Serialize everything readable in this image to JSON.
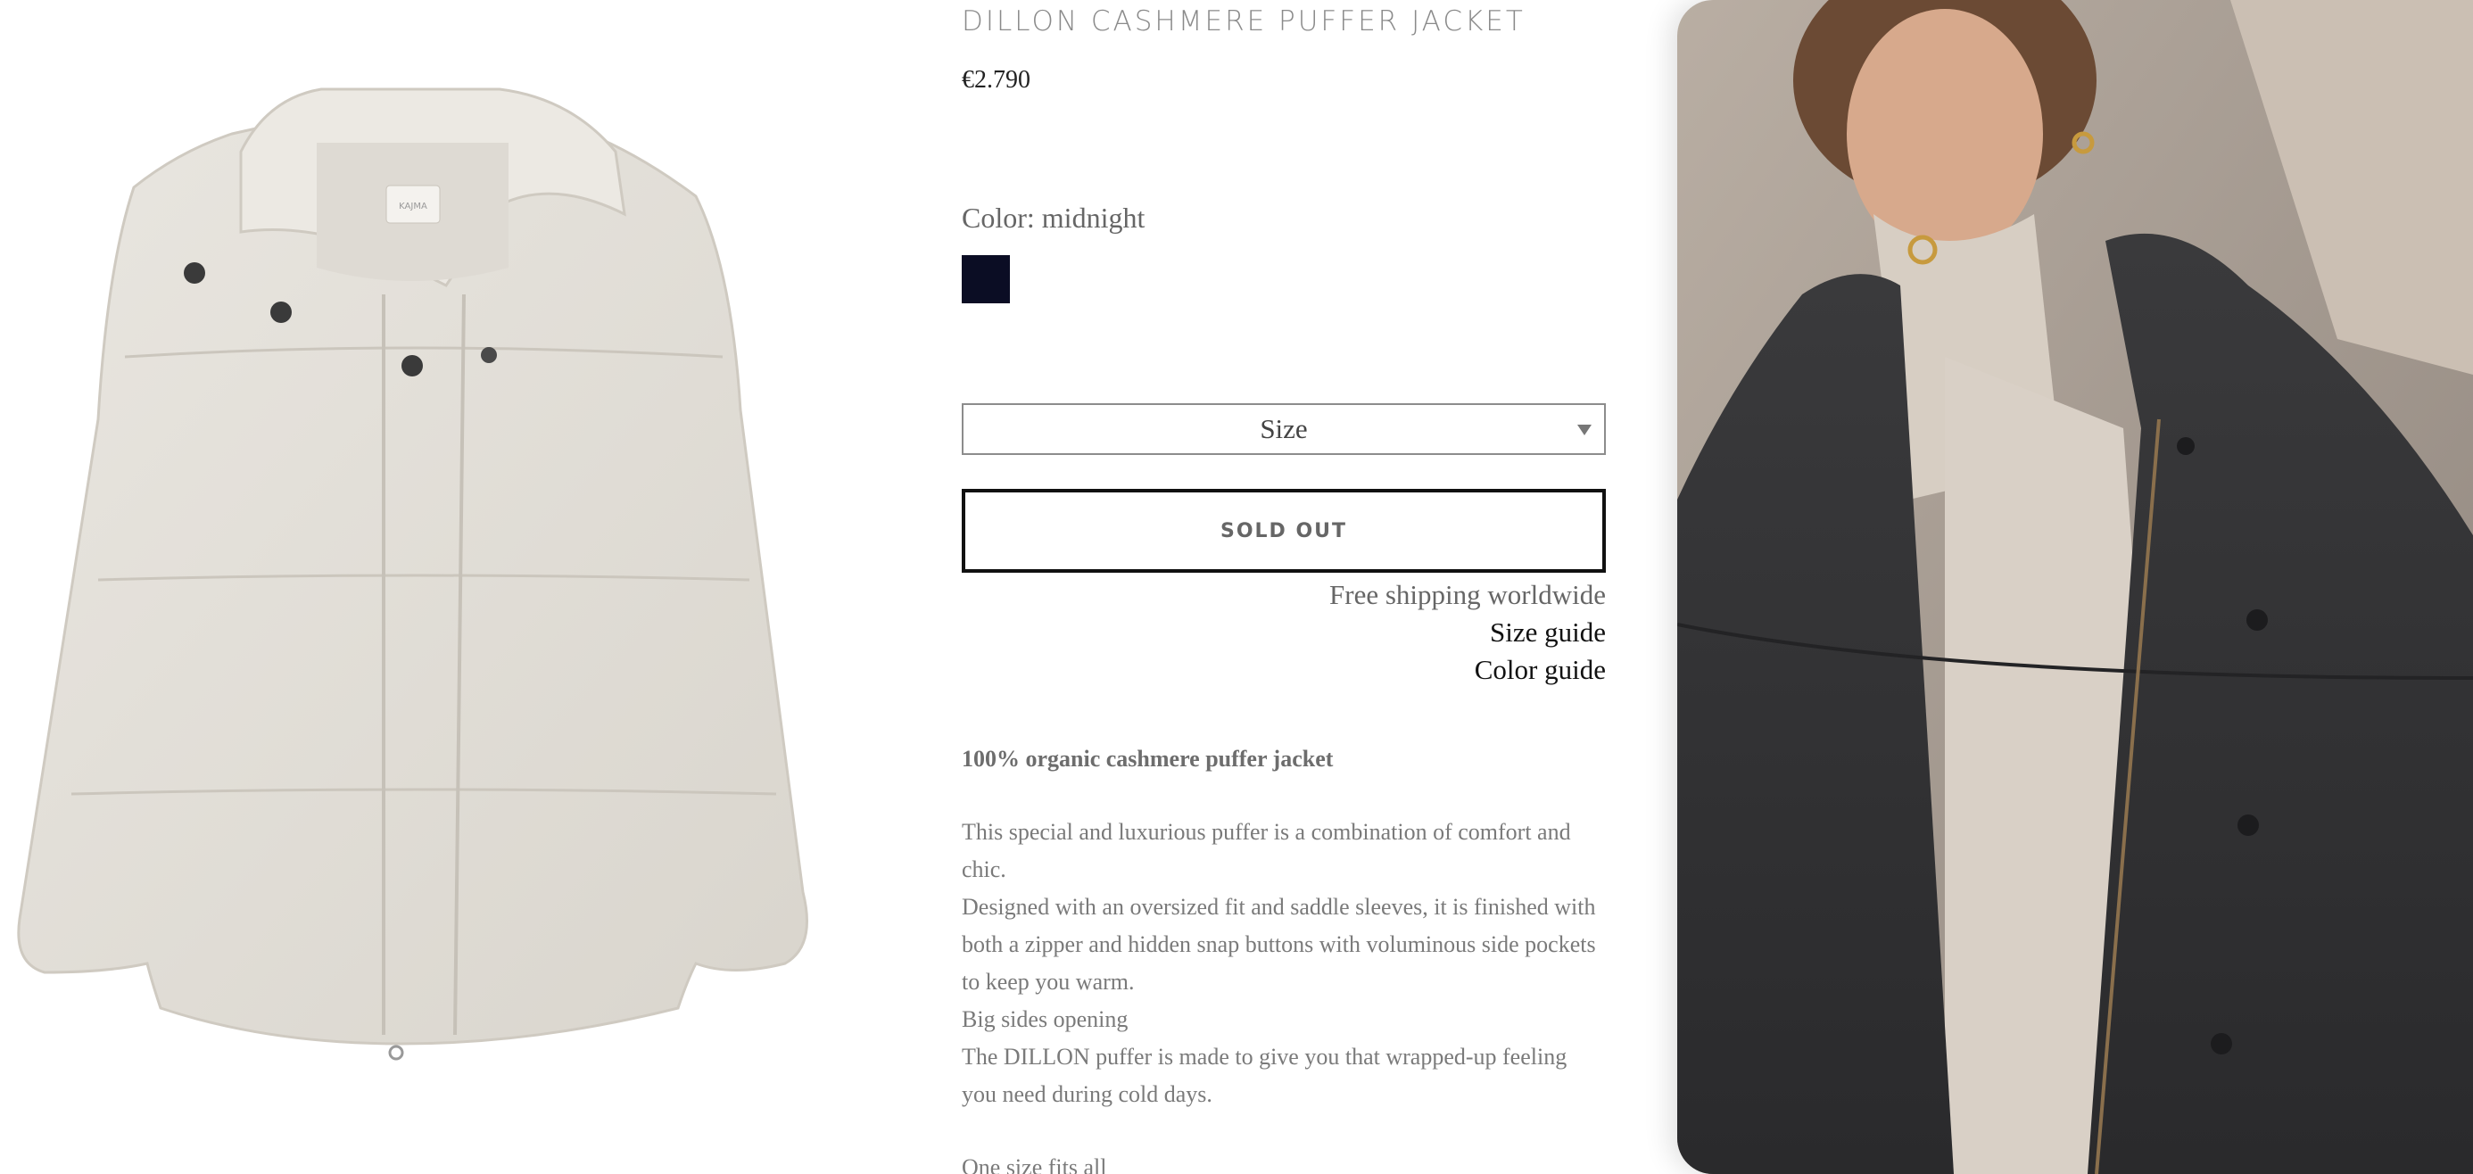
{
  "product": {
    "title": "DILLON CASHMERE PUFFER JACKET",
    "price": "€2.790",
    "color_label": "Color: midnight",
    "swatch_color": "#0b0d24",
    "size_select": "Size",
    "sold_out_label": "SOLD OUT",
    "links": {
      "free_shipping": "Free shipping worldwide",
      "size_guide": "Size guide",
      "color_guide": "Color guide"
    },
    "description": {
      "headline": "100% organic cashmere puffer jacket",
      "lines": [
        "This special and luxurious puffer is a combination of comfort and chic.",
        "Designed with an oversized fit and saddle sleeves, it is finished with both a zipper and hidden snap buttons with voluminous side pockets to keep you warm.",
        "Big sides opening",
        "The DILLON puffer is made to give you that wrapped-up feeling you need during cold days."
      ],
      "footer_line": "One size fits all"
    }
  },
  "images": {
    "product_label_text": "KAJMA",
    "product_image_icon": "puffer-jacket-image",
    "model_image_icon": "model-photo-image"
  }
}
